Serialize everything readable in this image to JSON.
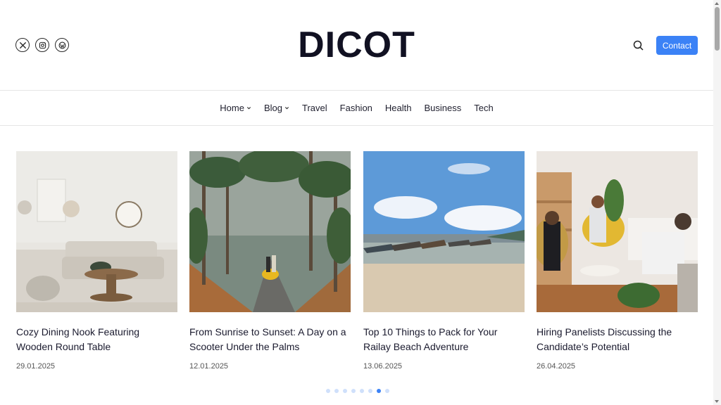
{
  "header": {
    "logo": "DICOT",
    "social_icons": [
      "x-icon",
      "instagram-icon",
      "wordpress-icon"
    ],
    "contact_label": "Contact",
    "accent_color": "#3b82f6"
  },
  "nav": {
    "items": [
      {
        "label": "Home",
        "has_dropdown": true
      },
      {
        "label": "Blog",
        "has_dropdown": true
      },
      {
        "label": "Travel",
        "has_dropdown": false
      },
      {
        "label": "Fashion",
        "has_dropdown": false
      },
      {
        "label": "Health",
        "has_dropdown": false
      },
      {
        "label": "Business",
        "has_dropdown": false
      },
      {
        "label": "Tech",
        "has_dropdown": false
      }
    ]
  },
  "posts": [
    {
      "title": "Cozy Dining Nook Featuring Wooden Round Table",
      "date": "29.01.2025"
    },
    {
      "title": "From Sunrise to Sunset: A Day on a Scooter Under the Palms",
      "date": "12.01.2025"
    },
    {
      "title": "Top 10 Things to Pack for Your Railay Beach Adventure",
      "date": "13.06.2025"
    },
    {
      "title": "Hiring Panelists Discussing the Candidate’s Potential",
      "date": "26.04.2025"
    }
  ],
  "carousel": {
    "total_slides": 8,
    "active_index": 6
  }
}
